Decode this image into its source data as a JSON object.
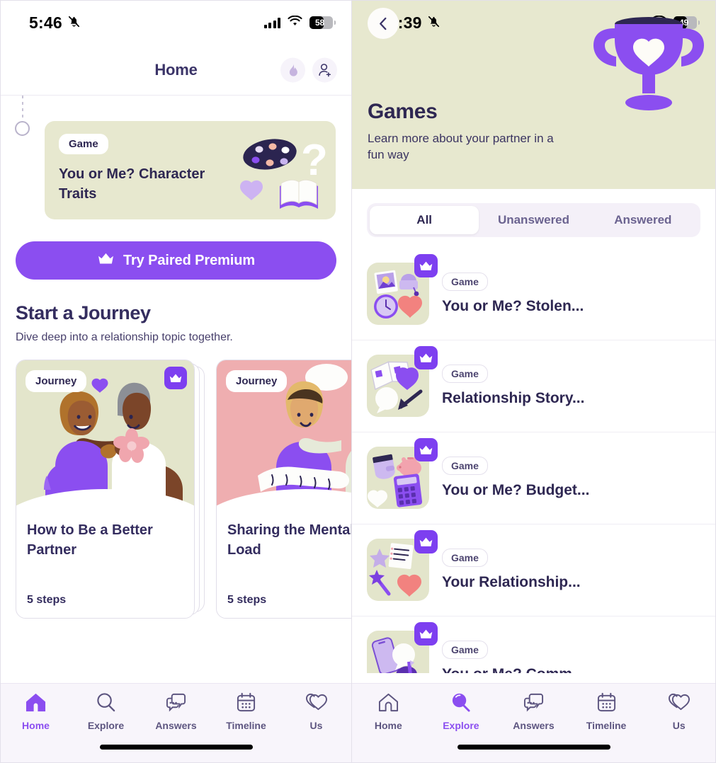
{
  "colors": {
    "purple": "#8b4ef0",
    "purple_deep": "#7d3ff0",
    "navy": "#2e2752",
    "olive": "#e7e8cf",
    "pink": "#efaeb0",
    "tab_bg": "#f8f5fb",
    "seg_bg": "#f4f0f8"
  },
  "left": {
    "status": {
      "time": "5:46",
      "battery": "58",
      "mute_icon": "bell-off-icon",
      "wifi_icon": "wifi-icon",
      "signal_icon": "cellular-signal-icon"
    },
    "header": {
      "title": "Home",
      "streak_icon": "flame-icon",
      "invite_icon": "add-person-icon"
    },
    "timeline_card": {
      "pill": "Game",
      "title": "You or Me? Character Traits",
      "art_icons": [
        "palette-icon",
        "question-mark-icon",
        "heart-icon",
        "open-book-icon"
      ]
    },
    "premium_button": {
      "label": "Try Paired Premium",
      "icon": "crown-icon"
    },
    "section": {
      "title": "Start a Journey",
      "subtitle": "Dive deep into a relationship topic together."
    },
    "journeys": [
      {
        "pill": "Journey",
        "title": "How to Be a Better Partner",
        "steps": "5 steps",
        "art": "couple-embracing-olive",
        "premium": true
      },
      {
        "pill": "Journey",
        "title": "Sharing the Mental Load",
        "steps": "5 steps",
        "art": "couple-paperwork-pink",
        "premium": false
      }
    ],
    "tabbar": {
      "active": "Home",
      "items": [
        {
          "label": "Home",
          "icon": "home-icon"
        },
        {
          "label": "Explore",
          "icon": "search-icon"
        },
        {
          "label": "Answers",
          "icon": "chat-bubbles-icon"
        },
        {
          "label": "Timeline",
          "icon": "calendar-icon"
        },
        {
          "label": "Us",
          "icon": "two-hearts-icon"
        }
      ]
    }
  },
  "right": {
    "status": {
      "time": "11:39",
      "battery": "49",
      "mute_icon": "bell-off-icon",
      "wifi_icon": "wifi-icon",
      "signal_icon": "cellular-signal-icon"
    },
    "back_icon": "chevron-left-icon",
    "hero": {
      "title": "Games",
      "subtitle": "Learn more about your partner in a fun way",
      "art": "trophy-with-heart-icon"
    },
    "segments": [
      {
        "label": "All",
        "active": true
      },
      {
        "label": "Unanswered",
        "active": false
      },
      {
        "label": "Answered",
        "active": false
      }
    ],
    "games": [
      {
        "pill": "Game",
        "title": "You or Me? Stolen...",
        "thumb": "photo-clock-heart-bag-icon",
        "premium": true
      },
      {
        "pill": "Game",
        "title": "Relationship Story...",
        "thumb": "book-shield-speech-icon",
        "premium": true
      },
      {
        "pill": "Game",
        "title": "You or Me? Budget...",
        "thumb": "wallet-piggybank-calculator-icon",
        "premium": true
      },
      {
        "pill": "Game",
        "title": "Your Relationship...",
        "thumb": "star-wand-list-heart-icon",
        "premium": true
      },
      {
        "pill": "Game",
        "title": "You or Me? Comm...",
        "thumb": "phone-mailbox-speech-icon",
        "premium": true
      }
    ],
    "tabbar": {
      "active": "Explore",
      "items": [
        {
          "label": "Home",
          "icon": "home-icon"
        },
        {
          "label": "Explore",
          "icon": "search-icon"
        },
        {
          "label": "Answers",
          "icon": "chat-bubbles-icon"
        },
        {
          "label": "Timeline",
          "icon": "calendar-icon"
        },
        {
          "label": "Us",
          "icon": "two-hearts-icon"
        }
      ]
    }
  }
}
